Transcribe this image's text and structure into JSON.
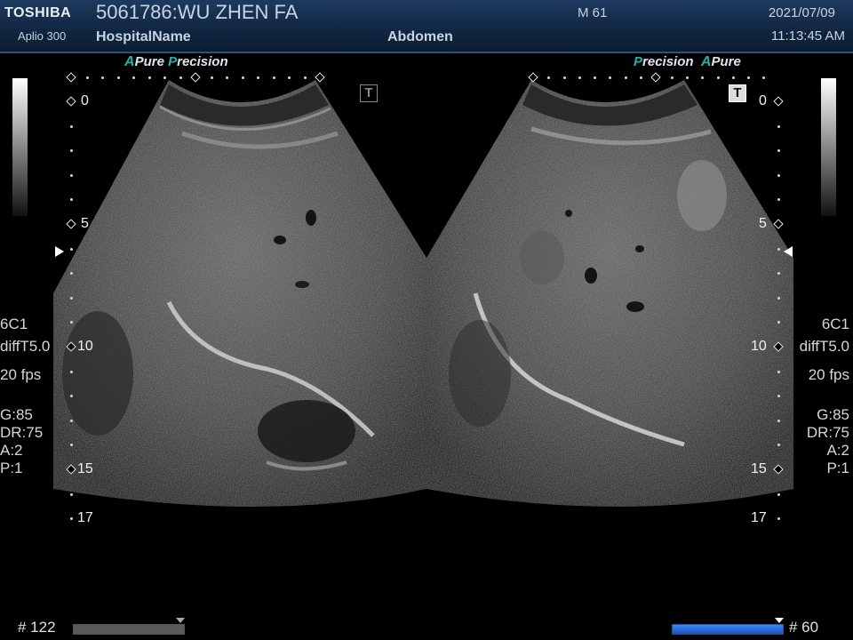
{
  "header": {
    "brand": "TOSHIBA",
    "model": "Aplio 300",
    "patient": "5061786:WU ZHEN FA",
    "hospital": "HospitalName",
    "exam": "Abdomen",
    "mi": "M 61",
    "date": "2021/07/09",
    "time": "11:13:45 AM"
  },
  "modes": {
    "left": {
      "a": "A",
      "pure": "Pure",
      "p": "P",
      "recision": "recision"
    },
    "right": {
      "p": "P",
      "recision": "recision",
      "a": "A",
      "pure": "Pure"
    }
  },
  "depth": {
    "d0": "0",
    "d5": "5",
    "d10": "10",
    "d15": "15",
    "d17": "17"
  },
  "settings": {
    "probe": "6C1",
    "filter": "diffT5.0",
    "fps": "20 fps",
    "gain": "G:85",
    "dr": "DR:75",
    "a": "A:2",
    "p": "P:1"
  },
  "bottom": {
    "left_frame": "# 122",
    "right_frame": "# 60",
    "left_progress": 1.0,
    "right_progress": 1.0
  },
  "icons": {
    "left_tag": "T",
    "right_tag": "T"
  },
  "colors": {
    "header": "#102640",
    "accent": "#22b3a8",
    "left_bar": "#5a5a5a",
    "right_bar": "#1f5fc8"
  }
}
